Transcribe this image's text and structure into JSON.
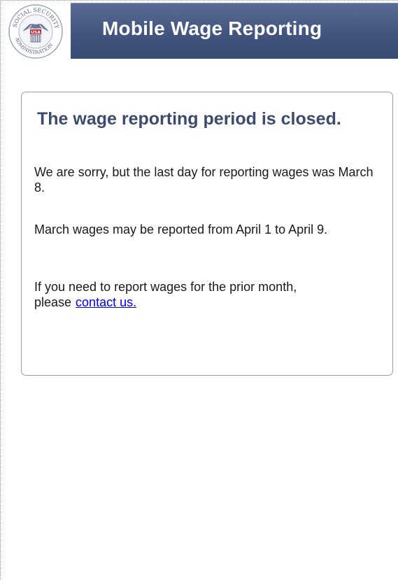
{
  "header": {
    "title": "Mobile Wage Reporting",
    "background_color": "#42557f"
  },
  "logo": {
    "name": "ssa-seal-icon",
    "text": "SOCIAL SECURITY ADMINISTRATION USA"
  },
  "notice": {
    "heading": "The wage reporting period is closed.",
    "paragraph1": "We are sorry, but the last day for reporting wages was March 8.",
    "paragraph2": "March wages may be reported from April 1 to April 9.",
    "paragraph3_prefix": "If you need to report wages for the prior month, please",
    "contact_link": "contact us."
  },
  "colors": {
    "heading": "#3c4a6b",
    "link": "#0000ee"
  }
}
